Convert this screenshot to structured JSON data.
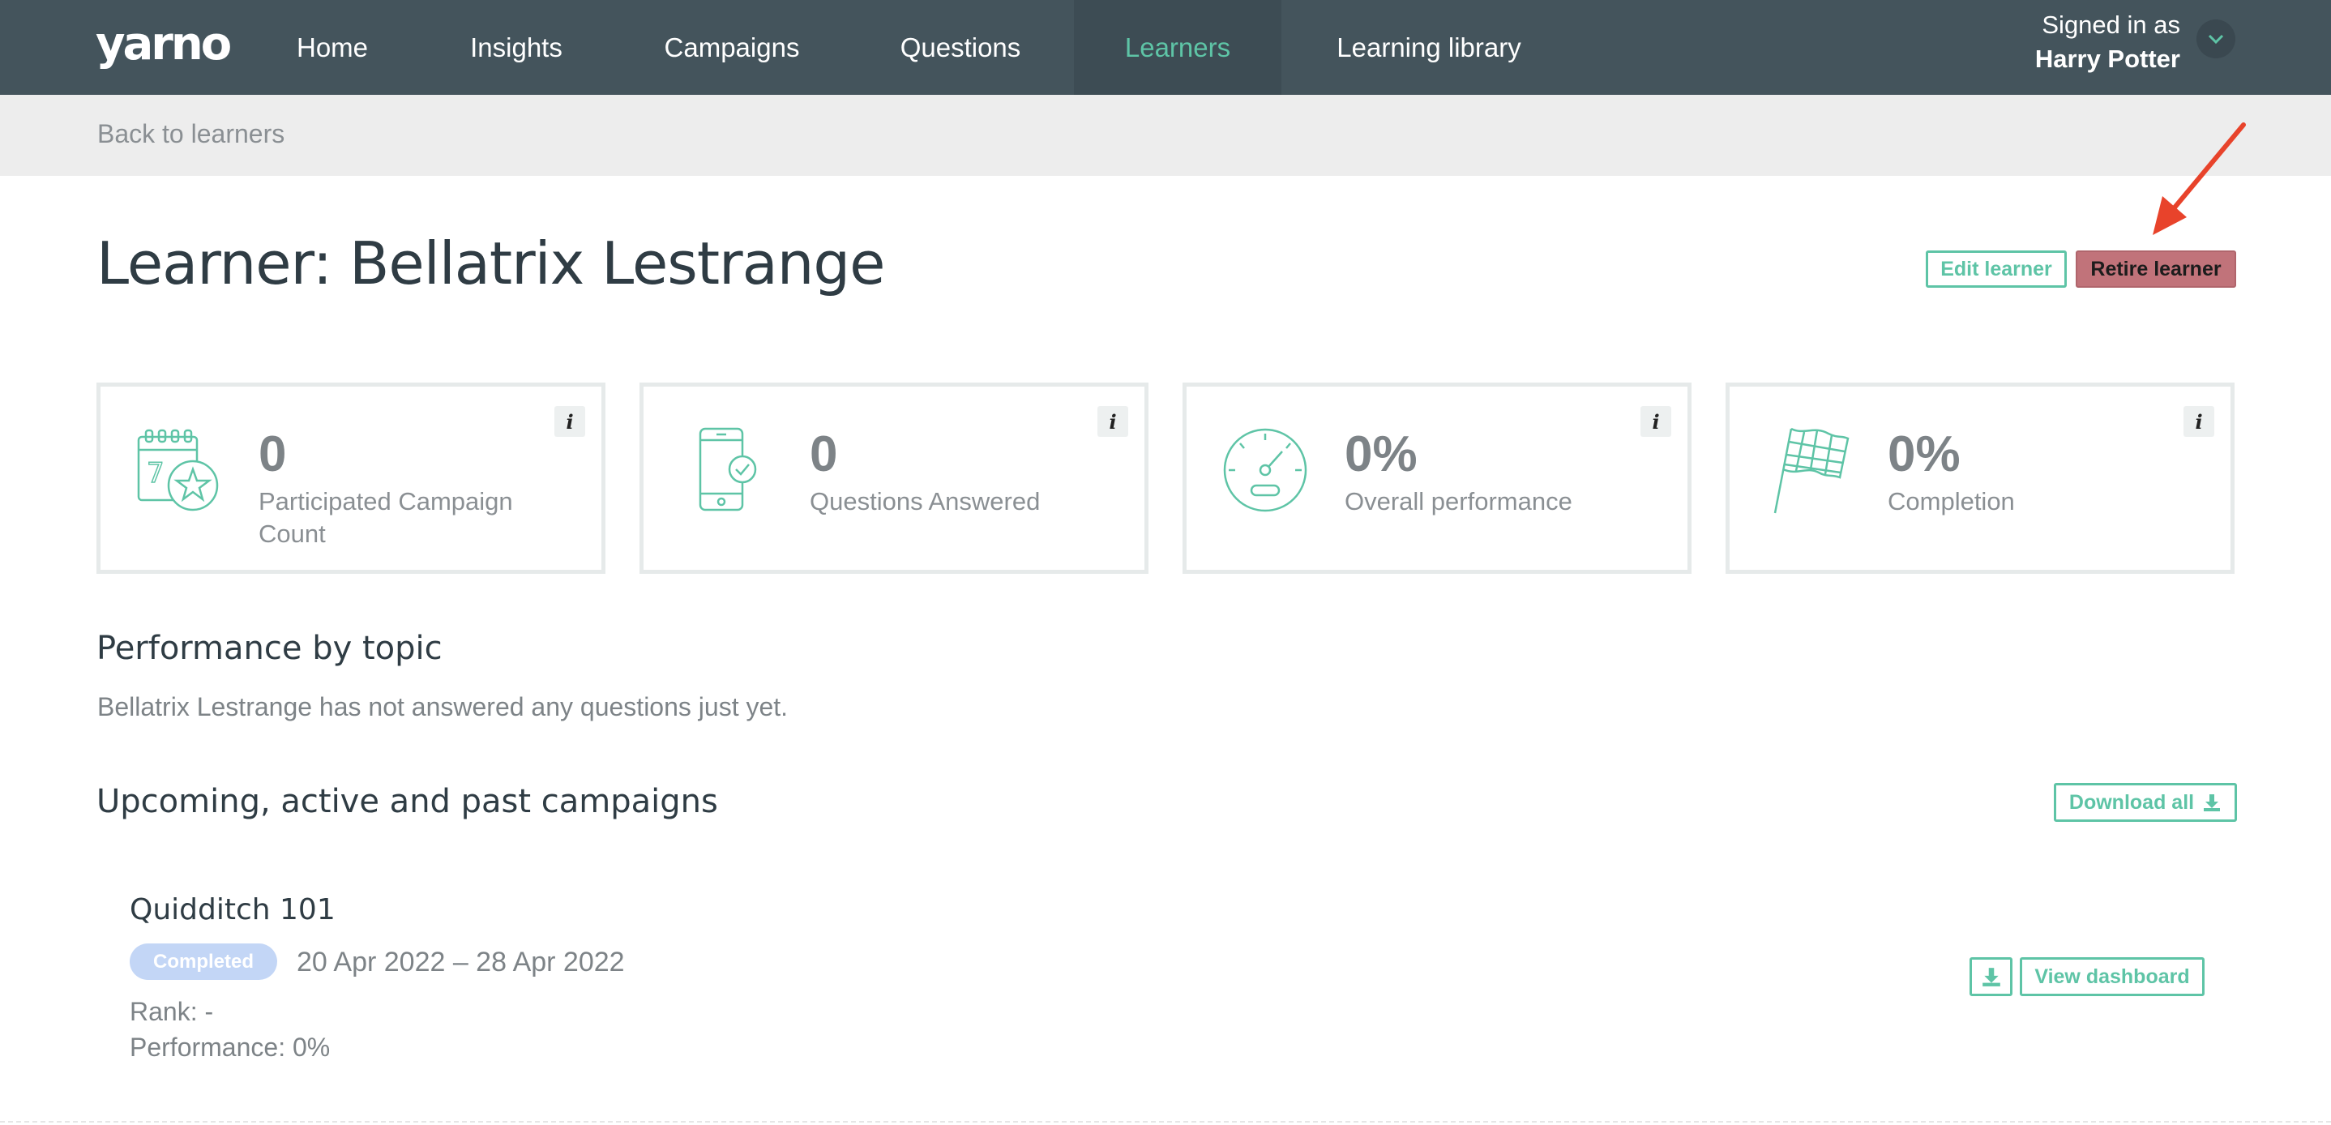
{
  "app": {
    "logo_text": "yarno"
  },
  "nav": {
    "items": [
      {
        "label": "Home"
      },
      {
        "label": "Insights"
      },
      {
        "label": "Campaigns"
      },
      {
        "label": "Questions"
      },
      {
        "label": "Learners",
        "active": true
      },
      {
        "label": "Learning library"
      }
    ],
    "signed_in_label": "Signed in as",
    "user_name": "Harry Potter",
    "user_menu_icon": "chevron-down-icon"
  },
  "subbar": {
    "back_link": "Back to learners"
  },
  "header": {
    "title": "Learner: Bellatrix Lestrange",
    "edit_button": "Edit learner",
    "retire_button": "Retire learner"
  },
  "stats": [
    {
      "icon": "calendar-star-icon",
      "value": "0",
      "label": "Participated Campaign Count",
      "info": "i"
    },
    {
      "icon": "phone-check-icon",
      "value": "0",
      "label": "Questions Answered",
      "info": "i"
    },
    {
      "icon": "speedometer-icon",
      "value": "0%",
      "label": "Overall performance",
      "info": "i"
    },
    {
      "icon": "checkered-flag-icon",
      "value": "0%",
      "label": "Completion",
      "info": "i"
    }
  ],
  "performance": {
    "title": "Performance by topic",
    "empty_text": "Bellatrix Lestrange has not answered any questions just yet."
  },
  "campaigns": {
    "title": "Upcoming, active and past campaigns",
    "download_all": "Download all",
    "items": [
      {
        "name": "Quidditch 101",
        "status": "Completed",
        "dates": "20 Apr 2022 – 28 Apr 2022",
        "rank": "Rank: -",
        "performance": "Performance: 0%",
        "view_button": "View dashboard"
      }
    ]
  },
  "colors": {
    "nav_bg": "#44545c",
    "accent": "#5ec4a6",
    "retire": "#c1737a",
    "badge": "#c3d6f6",
    "annotation_arrow": "#e8432b"
  }
}
